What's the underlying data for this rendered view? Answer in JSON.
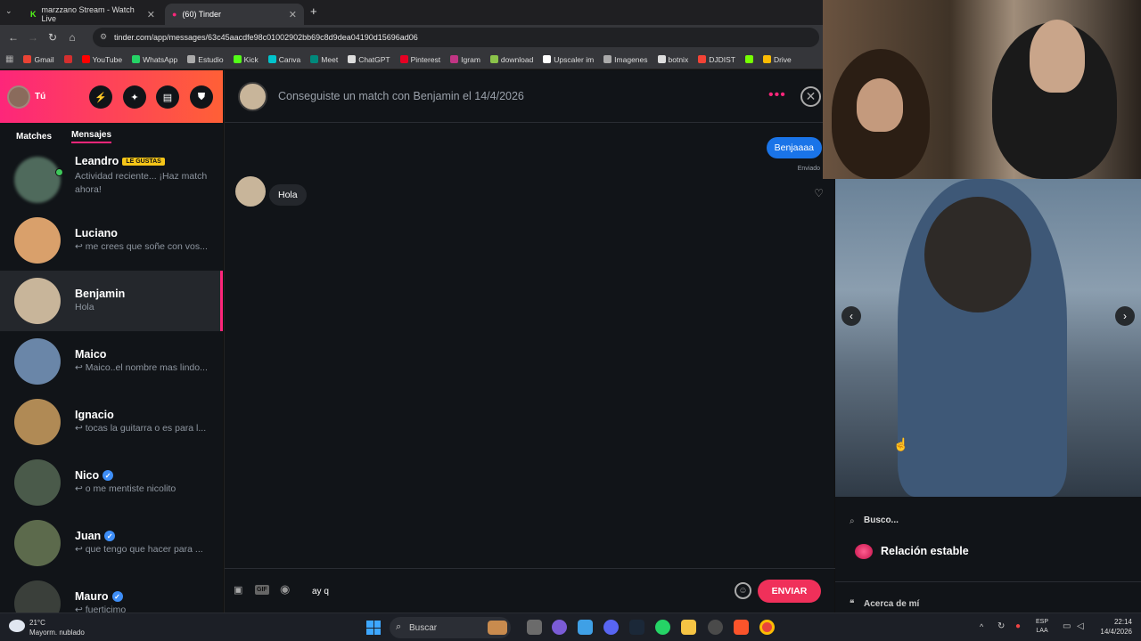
{
  "browser": {
    "tabs": [
      {
        "label": "marzzano Stream - Watch Live"
      },
      {
        "label": "(60) Tinder"
      }
    ],
    "new_tab": "+",
    "url": "tinder.com/app/messages/63c45aacdfe98c01002902bb69c8d9dea04190d15696ad06",
    "bookmarks": [
      {
        "label": "Gmail",
        "color": "#ea4335"
      },
      {
        "label": "",
        "color": "#d32f2f"
      },
      {
        "label": "YouTube",
        "color": "#ff0000"
      },
      {
        "label": "WhatsApp",
        "color": "#25d366"
      },
      {
        "label": "Estudio",
        "color": "#aaaaaa"
      },
      {
        "label": "Kick",
        "color": "#53fc18"
      },
      {
        "label": "Canva",
        "color": "#00c4cc"
      },
      {
        "label": "Meet",
        "color": "#00897b"
      },
      {
        "label": "ChatGPT",
        "color": "#dddddd"
      },
      {
        "label": "Pinterest",
        "color": "#e60023"
      },
      {
        "label": "Igram",
        "color": "#c13584"
      },
      {
        "label": "download",
        "color": "#8bc34a"
      },
      {
        "label": "Upscaler im",
        "color": "#ffffff"
      },
      {
        "label": "Imagenes",
        "color": "#aaaaaa"
      },
      {
        "label": "botnix",
        "color": "#dddddd"
      },
      {
        "label": "DJDIST",
        "color": "#f44336"
      },
      {
        "label": "",
        "color": "#76ff03"
      },
      {
        "label": "Drive",
        "color": "#fbbc04"
      }
    ]
  },
  "sidebar": {
    "me_label": "Tú",
    "tabs": [
      "Matches",
      "Mensajes"
    ],
    "conversations": [
      {
        "name": "Leandro",
        "badge": "LE GUSTAS",
        "snippet": "Actividad reciente... ¡Haz match ahora!",
        "verified": false,
        "color": "#4f6a5c"
      },
      {
        "name": "Luciano",
        "badge": "",
        "snippet": "↩ me crees que soñe con vos...",
        "verified": false,
        "color": "#d9a06b"
      },
      {
        "name": "Benjamin",
        "badge": "",
        "snippet": "Hola",
        "verified": false,
        "color": "#c8b59a"
      },
      {
        "name": "Maico",
        "badge": "",
        "snippet": "↩ Maico..el nombre mas lindo...",
        "verified": false,
        "color": "#6a86a8"
      },
      {
        "name": "Ignacio",
        "badge": "",
        "snippet": "↩ tocas la guitarra o es para l...",
        "verified": false,
        "color": "#b08a55"
      },
      {
        "name": "Nico",
        "badge": "",
        "snippet": "↩ o me mentiste nicolito",
        "verified": true,
        "color": "#4a5a4a"
      },
      {
        "name": "Juan",
        "badge": "",
        "snippet": "↩ que tengo que hacer para ...",
        "verified": true,
        "color": "#5c6a4c"
      },
      {
        "name": "Mauro",
        "badge": "",
        "snippet": "↩ fuerticimo",
        "verified": true,
        "color": "#3a3f3a"
      }
    ]
  },
  "chat": {
    "title": "Conseguiste un match con Benjamin el 14/4/2026",
    "outgoing": "Benjaaaa",
    "sent_label": "Enviado",
    "incoming": "Hola",
    "input_value": "ay q",
    "send_label": "ENVIAR",
    "gif_label": "GIF"
  },
  "profile": {
    "looking_for_label": "Busco...",
    "relationship": "Relación estable",
    "about_label": "Acerca de mí"
  },
  "taskbar": {
    "temp": "21°C",
    "weather": "Mayorm. nublado",
    "search": "Buscar",
    "lang1": "ESP",
    "lang2": "LAA",
    "time": "22:14",
    "date": "14/4/2026"
  }
}
